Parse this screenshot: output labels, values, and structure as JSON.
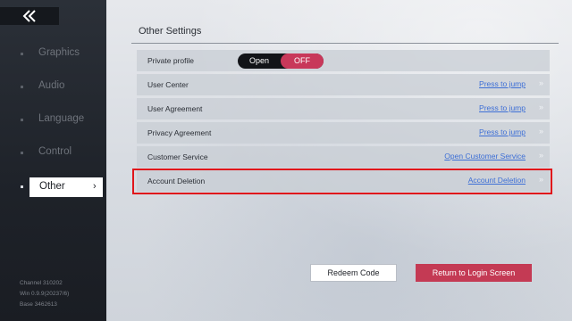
{
  "sidebar": {
    "back_icon": "double-chevron-left-icon",
    "items": [
      {
        "label": "Graphics"
      },
      {
        "label": "Audio"
      },
      {
        "label": "Language"
      },
      {
        "label": "Control"
      },
      {
        "label": "Other",
        "active": true
      }
    ],
    "version_lines": [
      "Channel 310202",
      "Win 0.9.9(20237/6)",
      "Base 3462613"
    ]
  },
  "main": {
    "section_title": "Other Settings",
    "private_profile": {
      "label": "Private profile",
      "options": [
        "Open",
        "OFF"
      ],
      "selected": "OFF"
    },
    "rows": [
      {
        "label": "User Center",
        "link": "Press to jump"
      },
      {
        "label": "User Agreement",
        "link": "Press to jump"
      },
      {
        "label": "Privacy Agreement",
        "link": "Press to jump"
      },
      {
        "label": "Customer Service",
        "link": "Open Customer Service"
      },
      {
        "label": "Account Deletion",
        "link": "Account Deletion"
      }
    ],
    "arrow_glyph": "»",
    "buttons": {
      "redeem": "Redeem Code",
      "return_login": "Return to Login Screen"
    }
  },
  "colors": {
    "accent_red": "#c43a54",
    "toggle_active": "#c8385a",
    "link_blue": "#3d6fd6",
    "highlight_border": "#e0151b"
  }
}
